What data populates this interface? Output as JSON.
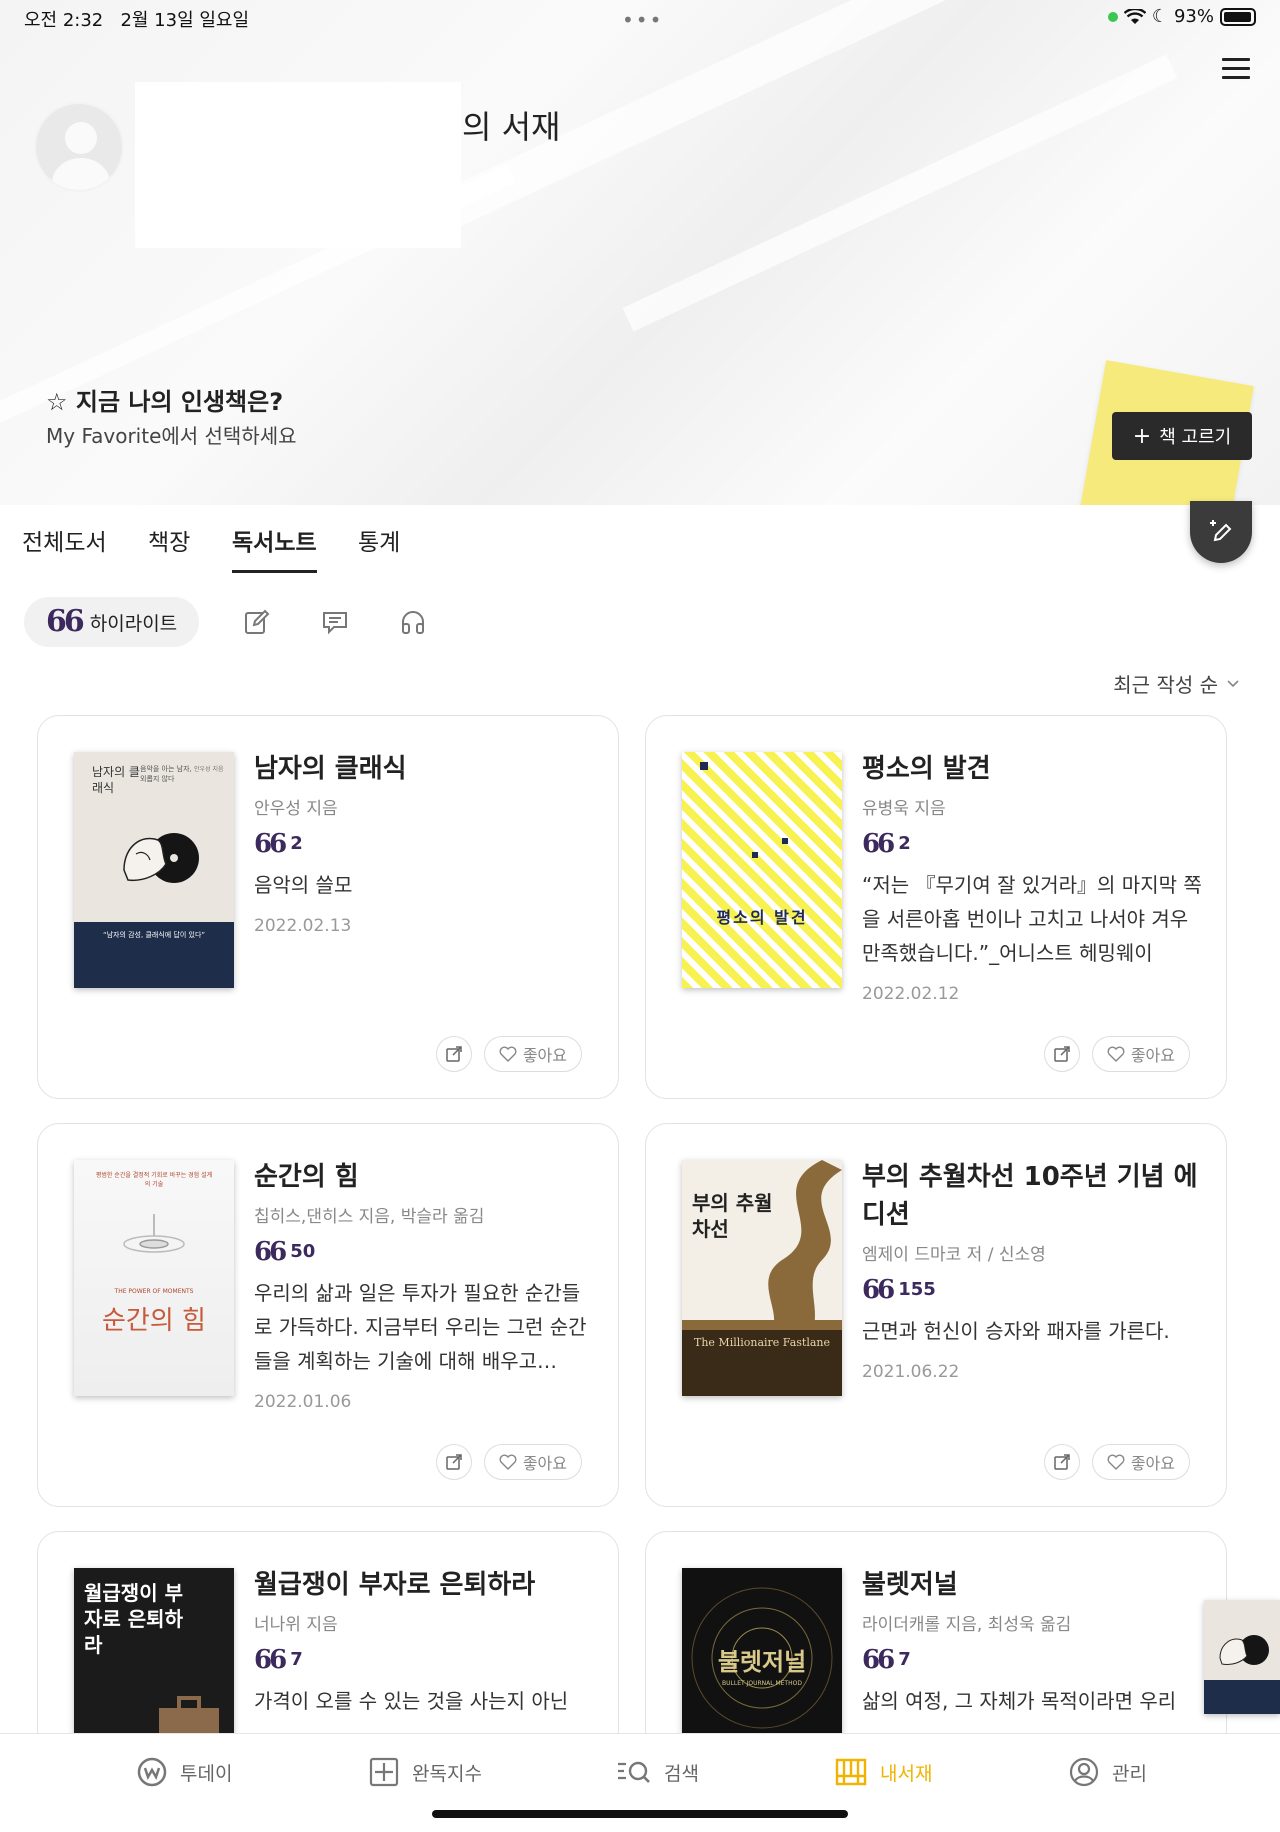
{
  "status": {
    "time": "오전 2:32",
    "date": "2월 13일 일요일",
    "battery": "93%"
  },
  "hero": {
    "library_title": "의 서재",
    "favorite_title": "☆ 지금 나의 인생책은?",
    "favorite_sub": "My Favorite에서 선택하세요",
    "pick_button": "책 고르기"
  },
  "tabs": [
    "전체도서",
    "책장",
    "독서노트",
    "통계"
  ],
  "active_tab": "독서노트",
  "filters": {
    "highlight_label": "하이라이트"
  },
  "sort_label": "최근 작성 순",
  "like_label": "좋아요",
  "books": [
    {
      "title": "남자의 클래식",
      "author": "안우성 지음",
      "count": "2",
      "quote": "음악의 쓸모",
      "date": "2022.02.13"
    },
    {
      "title": "평소의 발견",
      "author": "유병욱 지음",
      "count": "2",
      "quote": "“저는 『무기여 잘 있거라』의 마지막 쪽을 서른아홉 번이나 고치고 나서야 겨우 만족했습니다.”_어니스트 헤밍웨이",
      "date": "2022.02.12"
    },
    {
      "title": "순간의 힘",
      "author": "칩히스,댄히스 지음, 박슬라 옮김",
      "count": "50",
      "quote": "우리의 삶과 일은 투자가 필요한 순간들로 가득하다. 지금부터 우리는 그런 순간들을 계획하는 기술에 대해 배우고…",
      "date": "2022.01.06"
    },
    {
      "title": "부의 추월차선 10주년 기념 에디션",
      "author": "엠제이 드마코 저 / 신소영",
      "count": "155",
      "quote": "근면과 헌신이 승자와 패자를 가른다.",
      "date": "2021.06.22"
    },
    {
      "title": "월급쟁이 부자로 은퇴하라",
      "author": "너나위 지음",
      "count": "7",
      "quote": "가격이 오를 수 있는 것을 사는지 아닌",
      "date": ""
    },
    {
      "title": "불렛저널",
      "author": "라이더캐롤 지음, 최성욱 옮김",
      "count": "7",
      "quote": "삶의 여정, 그 자체가 목적이라면 우리",
      "date": ""
    }
  ],
  "covers": {
    "c1_title": "남자의 클래식",
    "c1_sub": "음악을 아는 남자, 외롭지 않다",
    "c1_author": "안우성 지음",
    "c1_band": "“남자의 감성, 클래식에 답이 있다”",
    "c2_title": "평소의 발견",
    "c3_top": "평범한 순간을 결정적 기회로 바꾸는 경험 설계의 기술",
    "c3_en": "THE POWER OF MOMENTS",
    "c3_title": "순간의 힘",
    "c4_title": "부의 추월차선",
    "c4_en": "The Millionaire Fastlane",
    "c5_title": "월급쟁이 부자로 은퇴하라",
    "c6_title": "불렛저널",
    "c6_en": "BULLET JOURNAL METHOD"
  },
  "bottom_nav": [
    "투데이",
    "완독지수",
    "검색",
    "내서재",
    "관리"
  ],
  "active_nav": "내서재",
  "colors": {
    "accent": "#f2b300",
    "quote": "#3c2a5e",
    "sticky": "#f7ea7c"
  }
}
